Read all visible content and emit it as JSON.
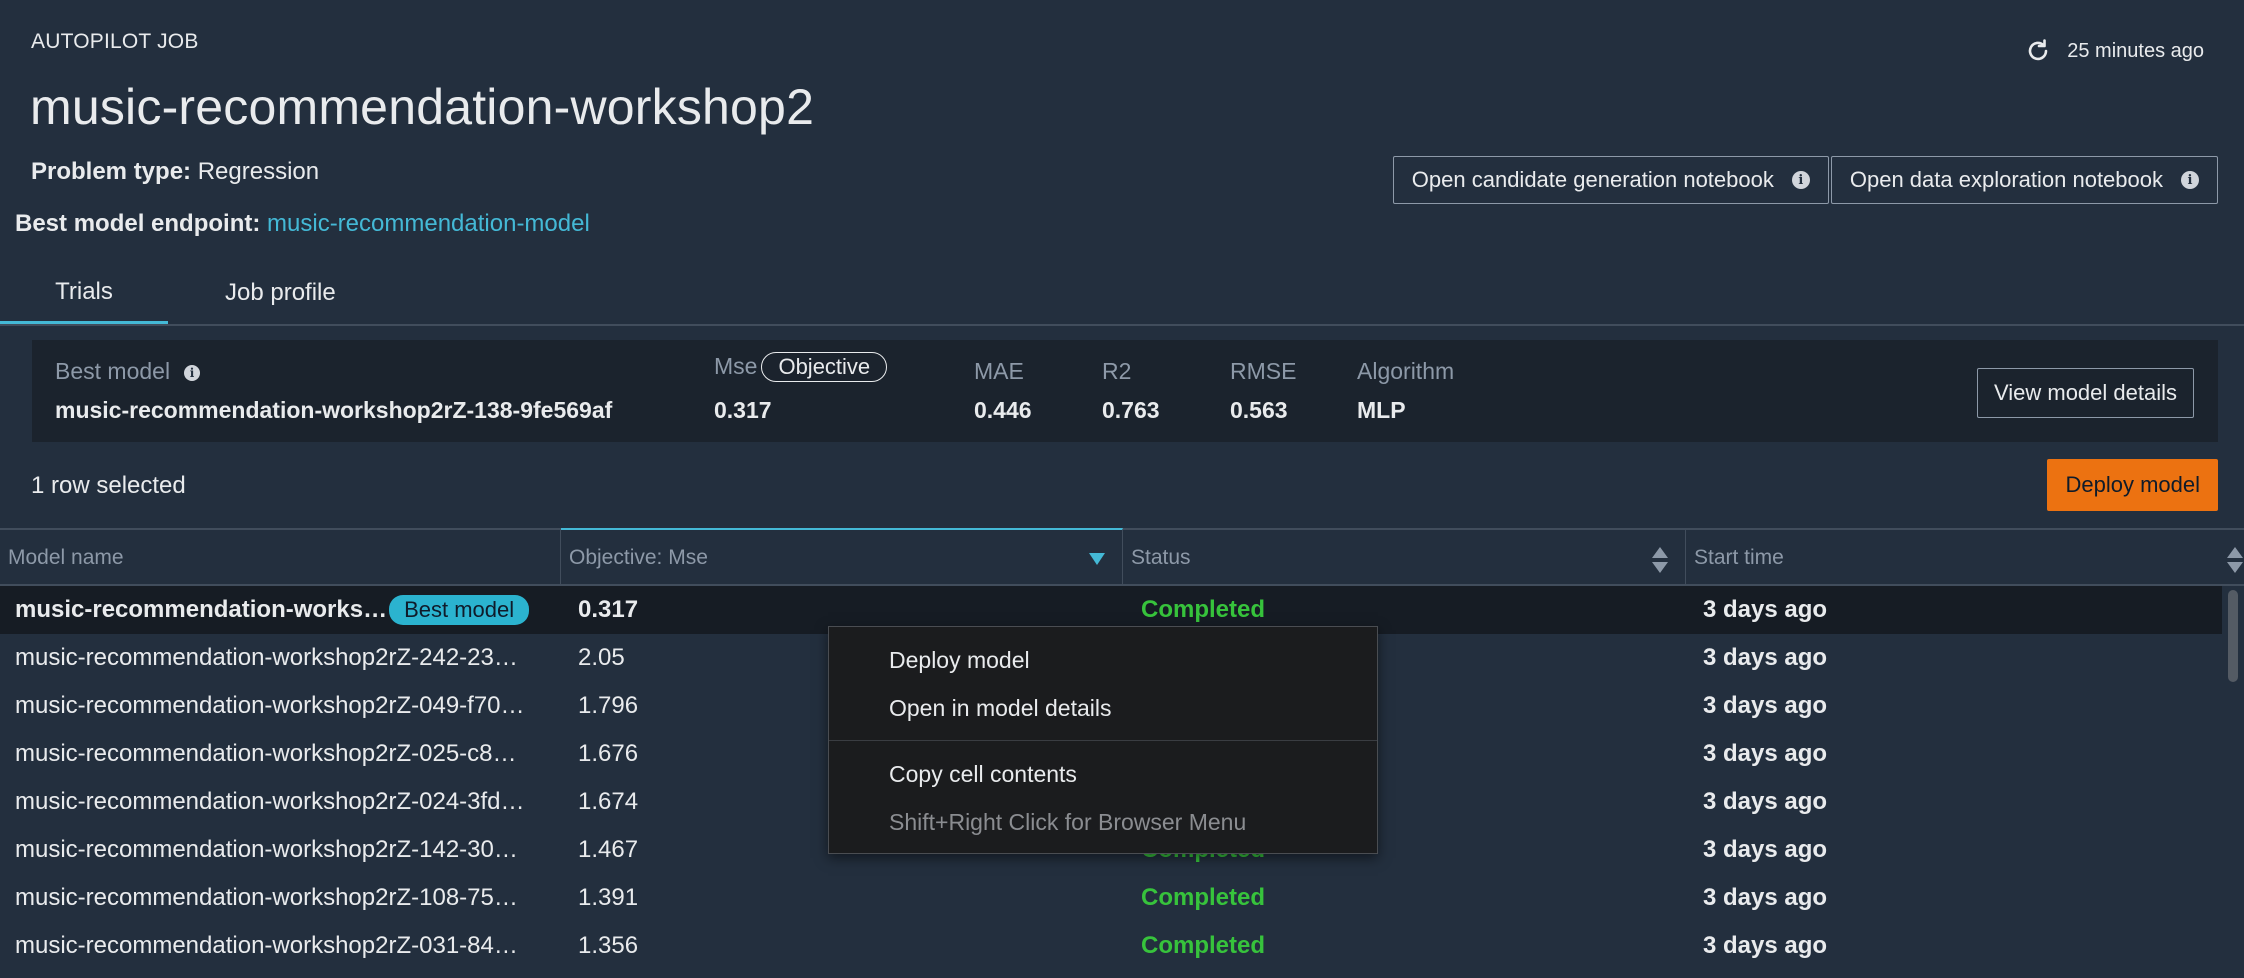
{
  "header": {
    "overline": "AUTOPILOT JOB",
    "title": "music-recommendation-workshop2",
    "problem_type_label": "Problem type:",
    "problem_type_value": "Regression",
    "endpoint_label": "Best model endpoint:",
    "endpoint_value": "music-recommendation-model",
    "refresh_time": "25 minutes ago",
    "buttons": {
      "candidate_notebook": "Open candidate generation notebook",
      "exploration_notebook": "Open data exploration notebook"
    }
  },
  "tabs": [
    {
      "label": "Trials",
      "active": true
    },
    {
      "label": "Job profile",
      "active": false
    }
  ],
  "best_model": {
    "label": "Best model",
    "name": "music-recommendation-workshop2rZ-138-9fe569af",
    "objective_badge": "Objective",
    "metrics": [
      {
        "label": "Mse",
        "value": "0.317"
      },
      {
        "label": "MAE",
        "value": "0.446"
      },
      {
        "label": "R2",
        "value": "0.763"
      },
      {
        "label": "RMSE",
        "value": "0.563"
      },
      {
        "label": "Algorithm",
        "value": "MLP"
      }
    ],
    "view_button": "View model details"
  },
  "selection": {
    "text": "1 row selected",
    "deploy_button": "Deploy model"
  },
  "table": {
    "columns": [
      "Model name",
      "Objective: Mse",
      "Status",
      "Start time"
    ],
    "best_badge": "Best model",
    "rows": [
      {
        "name": "music-recommendation-works…",
        "objective": "0.317",
        "status": "Completed",
        "start": "3 days ago",
        "selected": true,
        "best": true
      },
      {
        "name": "music-recommendation-workshop2rZ-242-23…",
        "objective": "2.05",
        "status": "",
        "start": "3 days ago"
      },
      {
        "name": "music-recommendation-workshop2rZ-049-f70…",
        "objective": "1.796",
        "status": "",
        "start": "3 days ago"
      },
      {
        "name": "music-recommendation-workshop2rZ-025-c8…",
        "objective": "1.676",
        "status": "",
        "start": "3 days ago"
      },
      {
        "name": "music-recommendation-workshop2rZ-024-3fd…",
        "objective": "1.674",
        "status": "",
        "start": "3 days ago"
      },
      {
        "name": "music-recommendation-workshop2rZ-142-30…",
        "objective": "1.467",
        "status": "Completed",
        "start": "3 days ago"
      },
      {
        "name": "music-recommendation-workshop2rZ-108-75…",
        "objective": "1.391",
        "status": "Completed",
        "start": "3 days ago"
      },
      {
        "name": "music-recommendation-workshop2rZ-031-84…",
        "objective": "1.356",
        "status": "Completed",
        "start": "3 days ago"
      }
    ]
  },
  "context_menu": {
    "items": [
      {
        "label": "Deploy model",
        "disabled": false
      },
      {
        "label": "Open in model details",
        "disabled": false
      },
      {
        "label": "Copy cell contents",
        "disabled": false
      },
      {
        "label": "Shift+Right Click for Browser Menu",
        "disabled": true
      }
    ]
  },
  "colors": {
    "background": "#232f3e",
    "accent": "#44b9d6",
    "deploy": "#ec7211",
    "status_completed": "#37c33c"
  }
}
